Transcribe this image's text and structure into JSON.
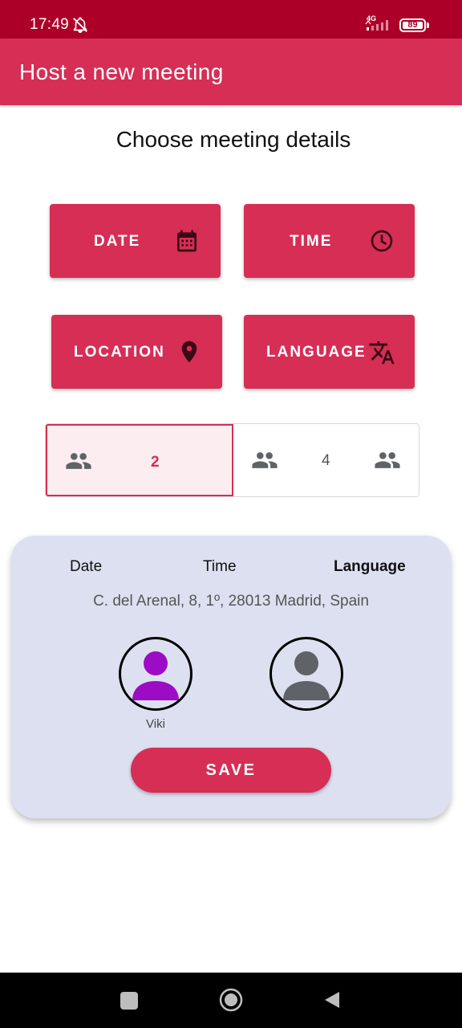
{
  "status_bar": {
    "time": "17:49",
    "network": "4G",
    "battery": "89",
    "icons": [
      "bell-off-icon",
      "signal-icon",
      "battery-icon"
    ]
  },
  "app_bar": {
    "title": "Host a new meeting"
  },
  "section_title": "Choose meeting details",
  "buttons": {
    "date": {
      "label": "DATE",
      "icon": "calendar-icon"
    },
    "time": {
      "label": "TIME",
      "icon": "clock-icon"
    },
    "location": {
      "label": "LOCATION",
      "icon": "location-pin-icon"
    },
    "language": {
      "label": "LANGUAGE",
      "icon": "translate-icon"
    }
  },
  "participants": {
    "options": [
      {
        "value": "2",
        "selected": true,
        "icon": "people-icon"
      },
      {
        "value": "4",
        "selected": false,
        "icon": "people-icon"
      }
    ]
  },
  "summary": {
    "date_label": "Date",
    "time_label": "Time",
    "language_label": "Language",
    "address": "C. del Arenal, 8, 1º, 28013 Madrid, Spain",
    "participants": [
      {
        "name": "Viki",
        "color": "#9c0cc4",
        "icon": "person-icon"
      },
      {
        "name": "",
        "color": "#5f6368",
        "icon": "person-icon"
      }
    ],
    "save_label": "SAVE"
  },
  "colors": {
    "status_bar": "#ad0029",
    "primary": "#d62e55",
    "card_bg": "#dde0f0",
    "selected_bg": "#fbedf0"
  },
  "nav_bar": {
    "icons": [
      "recents-icon",
      "home-icon",
      "back-icon"
    ]
  }
}
